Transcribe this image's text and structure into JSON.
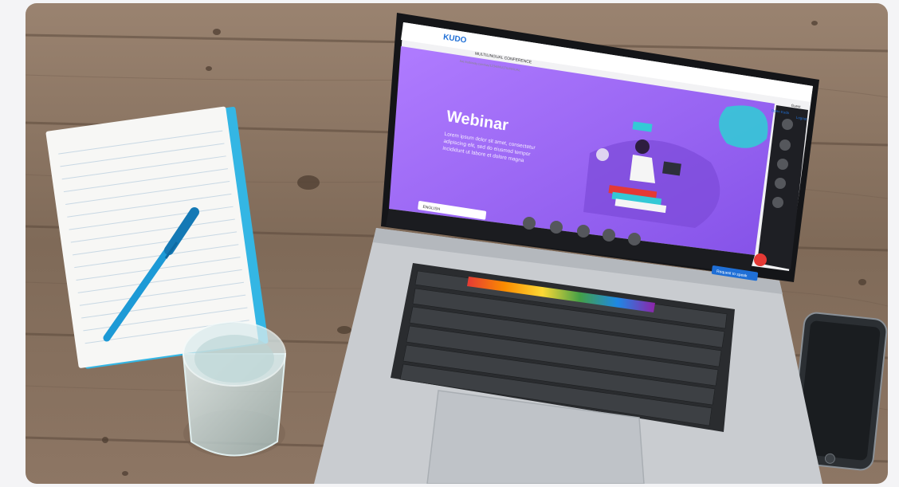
{
  "scene": {
    "description_tag": "photo",
    "app_logo": "KUDO",
    "conference_label": "MULTILINGUAL CONFERENCE",
    "url": "live.kudoway.com/ws/1234/MULTILINGUAL",
    "user_name": "Guest",
    "top_links": [
      "Open Kudo",
      "Logout"
    ],
    "hero_title": "Webinar",
    "hero_body": [
      "Lorem ipsum dolor sit amet, consectetur",
      "adipiscing elit, sed do eiusmod tempor",
      "incididunt ut labore et dolore magna"
    ],
    "language_select": "ENGLISH",
    "request_button": "Request to speak",
    "sidebar_icons": [
      "chat-icon",
      "video-icon",
      "document-icon",
      "notes-icon",
      "people-icon"
    ],
    "toolbar_icons": [
      "speaker-icon",
      "signal-icon",
      "mic-icon",
      "camera-icon",
      "share-icon"
    ],
    "colors": {
      "wood": "#8a735f",
      "screen_purple": "#9b6cf5",
      "accent_teal": "#34c9d6",
      "button_blue": "#1f6fd6",
      "leave_red": "#e53935",
      "notebook_blue": "#34b6e4"
    }
  }
}
